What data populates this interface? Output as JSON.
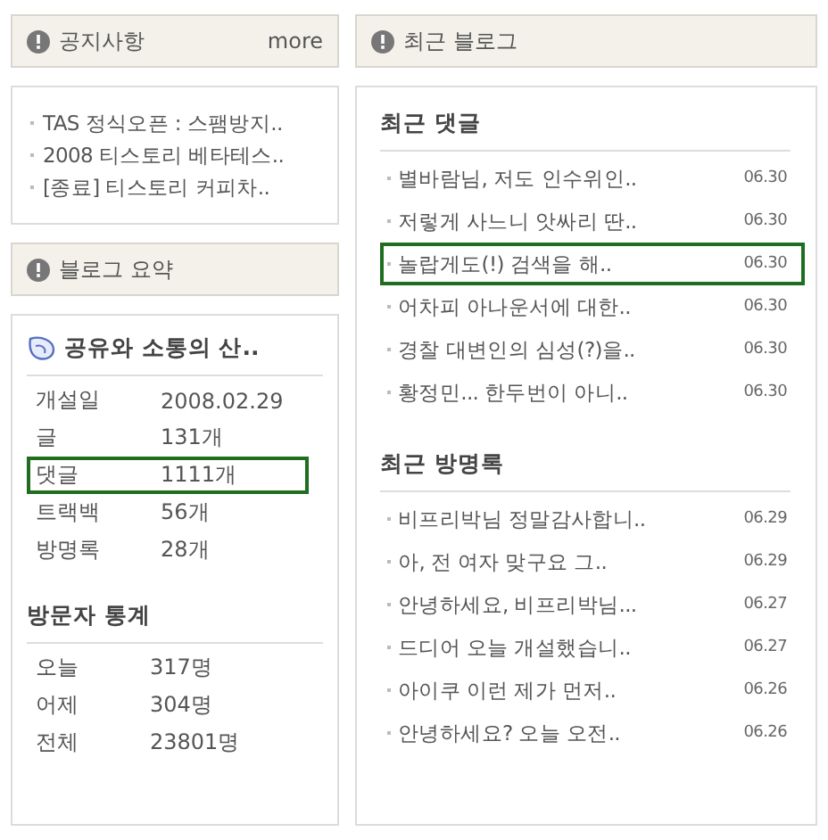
{
  "notice": {
    "title": "공지사항",
    "more": "more",
    "items": [
      "TAS 정식오픈 : 스팸방지..",
      "2008 티스토리 베타테스..",
      "[종료] 티스토리 커피차.."
    ]
  },
  "summary": {
    "title": "블로그 요약",
    "blog_name": "공유와 소통의 산..",
    "stats": [
      {
        "label": "개설일",
        "value": "2008.02.29",
        "highlighted": false
      },
      {
        "label": "글",
        "value": "131개",
        "highlighted": false
      },
      {
        "label": "댓글",
        "value": "1111개",
        "highlighted": true
      },
      {
        "label": "트랙백",
        "value": "56개",
        "highlighted": false
      },
      {
        "label": "방명록",
        "value": "28개",
        "highlighted": false
      }
    ],
    "visitors_title": "방문자 통계",
    "visitors": [
      {
        "label": "오늘",
        "value": "317명"
      },
      {
        "label": "어제",
        "value": "304명"
      },
      {
        "label": "전체",
        "value": "23801명"
      }
    ]
  },
  "recent": {
    "title": "최근 블로그",
    "sections": [
      {
        "title": "최근 댓글",
        "items": [
          {
            "text": "별바람님, 저도 인수위인..",
            "date": "06.30",
            "highlighted": false
          },
          {
            "text": "저렇게 사느니 앗싸리 딴..",
            "date": "06.30",
            "highlighted": false
          },
          {
            "text": "놀랍게도(!) 검색을 해..",
            "date": "06.30",
            "highlighted": true
          },
          {
            "text": "어차피 아나운서에 대한..",
            "date": "06.30",
            "highlighted": false
          },
          {
            "text": "경찰 대변인의 심성(?)을..",
            "date": "06.30",
            "highlighted": false
          },
          {
            "text": "황정민... 한두번이 아니..",
            "date": "06.30",
            "highlighted": false
          }
        ]
      },
      {
        "title": "최근 방명록",
        "items": [
          {
            "text": "비프리박님 정말감사합니..",
            "date": "06.29",
            "highlighted": false
          },
          {
            "text": "아, 전 여자 맞구요 그..",
            "date": "06.29",
            "highlighted": false
          },
          {
            "text": "안녕하세요, 비프리박님...",
            "date": "06.27",
            "highlighted": false
          },
          {
            "text": "드디어 오늘 개설했습니..",
            "date": "06.27",
            "highlighted": false
          },
          {
            "text": "아이쿠 이런 제가 먼저..",
            "date": "06.26",
            "highlighted": false
          },
          {
            "text": "안녕하세요? 오늘 오전..",
            "date": "06.26",
            "highlighted": false
          }
        ]
      }
    ]
  }
}
